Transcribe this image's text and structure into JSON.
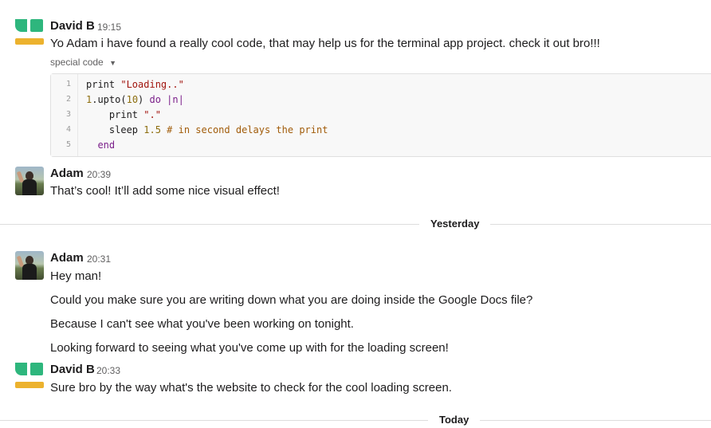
{
  "messages": [
    {
      "author": "David B",
      "time": "19:15",
      "text": "Yo Adam i have found a really cool code, that may help us for the terminal app project. check it out bro!!!"
    },
    {
      "author": "Adam",
      "time": "20:39",
      "text": "That’s cool! It’ll add some nice visual effect!"
    },
    {
      "author": "Adam",
      "time": "20:31",
      "lines": [
        "Hey man!",
        "Could you make sure you are writing down what you are doing inside the Google Docs file?",
        "Because I can't see what you've been working on tonight.",
        "Looking forward to seeing what you've come up with for the loading screen!"
      ]
    },
    {
      "author": "David B",
      "time": "20:33",
      "text": "Sure bro by the way what's the website to check for the cool loading screen."
    }
  ],
  "snippet": {
    "label": "special code",
    "caret_icon": "caret-down-icon",
    "line_numbers": [
      "1",
      "2",
      "3",
      "4",
      "5"
    ],
    "lines": [
      {
        "a": "print ",
        "b": "\"Loading..\""
      },
      {
        "a": "1",
        "b": ".upto(",
        "c": "10",
        "d": ") ",
        "e": "do",
        "f": " |n|"
      },
      {
        "a": "    print ",
        "b": "\".\""
      },
      {
        "a": "    sleep ",
        "b": "1.5",
        "c": " # in second delays the print"
      },
      {
        "a": "  end"
      }
    ]
  },
  "dividers": {
    "yesterday": "Yesterday",
    "today": "Today"
  },
  "colors": {
    "green": "#2eb67d",
    "yellow": "#ecb22e"
  }
}
